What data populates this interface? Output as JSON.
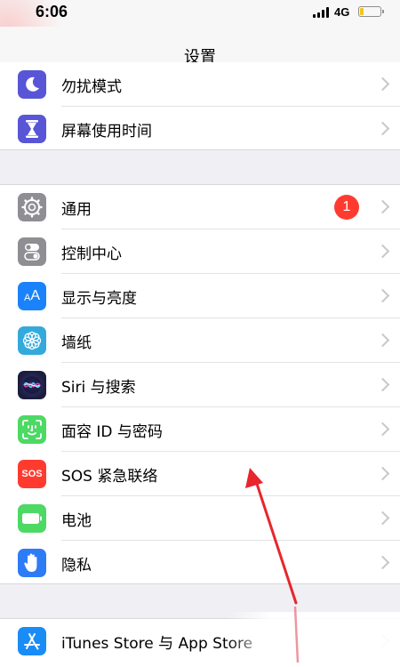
{
  "status_bar": {
    "time": "6:06",
    "network": "4G",
    "battery_level": 0.2
  },
  "nav": {
    "title": "设置"
  },
  "groups": [
    {
      "rows": [
        {
          "label": "勿扰模式",
          "icon": "moon-icon",
          "color": "#5856d6"
        },
        {
          "label": "屏幕使用时间",
          "icon": "hourglass-icon",
          "color": "#5856d6"
        }
      ]
    },
    {
      "rows": [
        {
          "label": "通用",
          "icon": "gear-icon",
          "color": "#8e8e93",
          "badge": "1"
        },
        {
          "label": "控制中心",
          "icon": "toggles-icon",
          "color": "#8e8e93"
        },
        {
          "label": "显示与亮度",
          "icon": "text-size-icon",
          "color": "#1a82fb",
          "icon_text": "AA"
        },
        {
          "label": "墙纸",
          "icon": "flower-icon",
          "color": "#34aadc"
        },
        {
          "label": "Siri 与搜索",
          "icon": "siri-icon",
          "color": "#1c1c3c"
        },
        {
          "label": "面容 ID 与密码",
          "icon": "face-id-icon",
          "color": "#4cd964"
        },
        {
          "label": "SOS 紧急联络",
          "icon": "sos-icon",
          "color": "#ff3b30",
          "icon_text": "SOS"
        },
        {
          "label": "电池",
          "icon": "battery-icon",
          "color": "#4cd964"
        },
        {
          "label": "隐私",
          "icon": "hand-icon",
          "color": "#2d7cf6"
        }
      ]
    },
    {
      "rows": [
        {
          "label": "iTunes Store 与 App Store",
          "icon": "app-store-icon",
          "color": "#1a8cf5"
        }
      ]
    }
  ]
}
